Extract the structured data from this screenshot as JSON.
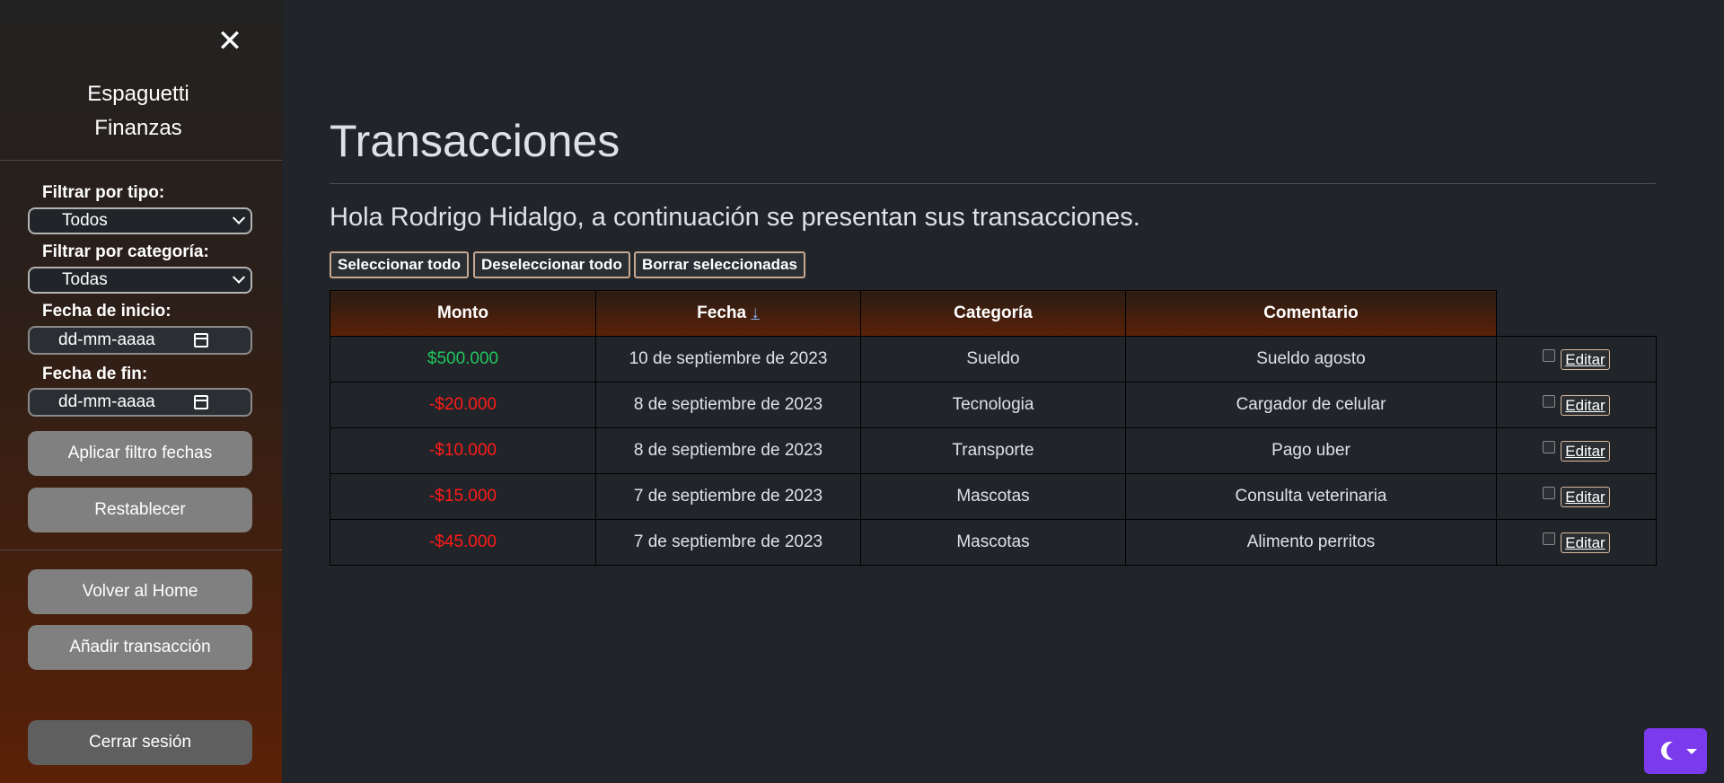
{
  "sidebar": {
    "close_symbol": "✕",
    "brand_line1": "Espaguetti",
    "brand_line2": "Finanzas",
    "filter_type_label": "Filtrar por tipo:",
    "filter_type_value": "Todos",
    "filter_category_label": "Filtrar por categoría:",
    "filter_category_value": "Todas",
    "start_date_label": "Fecha de inicio:",
    "start_date_placeholder": "dd-mm-aaaa",
    "end_date_label": "Fecha de fin:",
    "end_date_placeholder": "dd-mm-aaaa",
    "apply_filter_button": "Aplicar filtro fechas",
    "reset_button": "Restablecer",
    "home_button": "Volver al Home",
    "add_transaction_button": "Añadir transacción",
    "logout_button": "Cerrar sesión"
  },
  "main": {
    "title": "Transacciones",
    "greeting": "Hola Rodrigo Hidalgo, a continuación se presentan sus transacciones.",
    "actions": {
      "select_all": "Seleccionar todo",
      "deselect_all": "Deseleccionar todo",
      "delete_selected": "Borrar seleccionadas"
    },
    "table": {
      "headers": {
        "amount": "Monto",
        "date": "Fecha",
        "date_sort_arrow": "↓",
        "category": "Categoría",
        "comment": "Comentario"
      },
      "edit_label": "Editar",
      "rows": [
        {
          "amount": "$500.000",
          "amount_type": "positive",
          "date": "10 de septiembre de 2023",
          "category": "Sueldo",
          "comment": "Sueldo agosto"
        },
        {
          "amount": "-$20.000",
          "amount_type": "negative",
          "date": "8 de septiembre de 2023",
          "category": "Tecnologia",
          "comment": "Cargador de celular"
        },
        {
          "amount": "-$10.000",
          "amount_type": "negative",
          "date": "8 de septiembre de 2023",
          "category": "Transporte",
          "comment": "Pago uber"
        },
        {
          "amount": "-$15.000",
          "amount_type": "negative",
          "date": "7 de septiembre de 2023",
          "category": "Mascotas",
          "comment": "Consulta veterinaria"
        },
        {
          "amount": "-$45.000",
          "amount_type": "negative",
          "date": "7 de septiembre de 2023",
          "category": "Mascotas",
          "comment": "Alimento perritos"
        }
      ]
    }
  },
  "theme_toggle": {
    "icon": "moon-stars-icon"
  },
  "colors": {
    "positive": "#22c55e",
    "negative": "#ff1a1a",
    "accent_purple": "#7c3aed",
    "header_brown": "#5a2107"
  }
}
